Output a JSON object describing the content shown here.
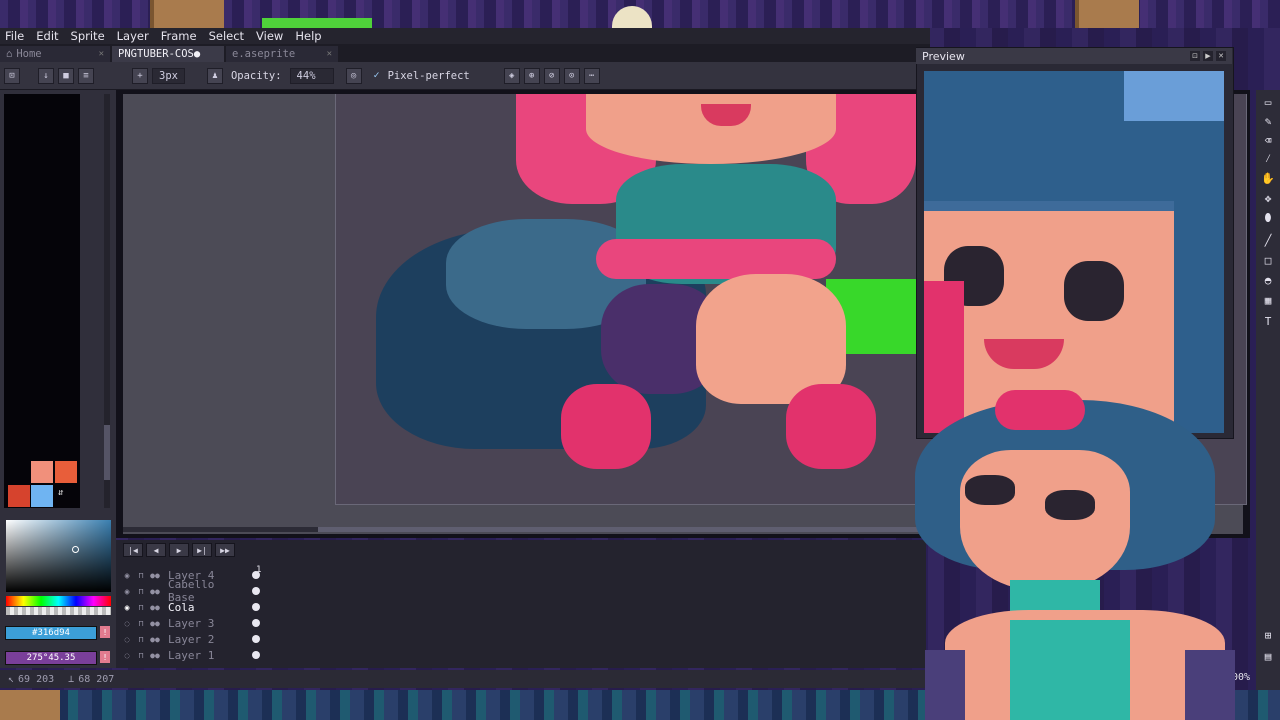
{
  "menubar": {
    "items": [
      "File",
      "Edit",
      "Sprite",
      "Layer",
      "Frame",
      "Select",
      "View",
      "Help"
    ]
  },
  "tabs": [
    {
      "label": "Home",
      "active": false
    },
    {
      "label": "PNGTUBER-COS●",
      "active": true
    },
    {
      "label": "e.aseprite",
      "active": false
    }
  ],
  "toolbar": {
    "brush_size": "3px",
    "opacity_label": "Opacity:",
    "opacity_value": "44%",
    "pixel_perfect_label": "Pixel-perfect",
    "pixel_perfect_checked": true
  },
  "color": {
    "hex": "#316d94",
    "hsv": "275°45.35",
    "swatches": [
      "#f1907b",
      "#e85e3a",
      "#d6432d",
      "#6fb4f2"
    ]
  },
  "layers": [
    {
      "name": "Layer 4",
      "active": false
    },
    {
      "name": "Cabello Base",
      "active": false
    },
    {
      "name": "Cola",
      "active": true
    },
    {
      "name": "Layer 3",
      "active": false
    },
    {
      "name": "Layer 2",
      "active": false
    },
    {
      "name": "Layer 1",
      "active": false
    }
  ],
  "timeline": {
    "frame": "1"
  },
  "status": {
    "cursor": "69 203",
    "size": "68 207",
    "zoom": "200%"
  },
  "preview": {
    "title": "Preview"
  }
}
